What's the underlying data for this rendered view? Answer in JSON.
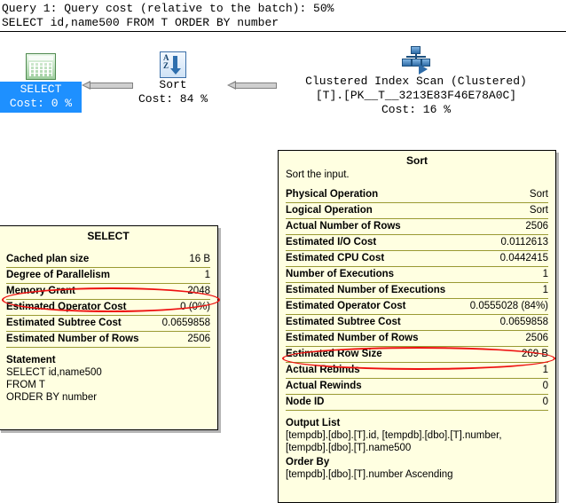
{
  "header": {
    "line1": "Query 1: Query cost (relative to the batch): 50%",
    "line2": "SELECT id,name500 FROM T ORDER BY number"
  },
  "plan": {
    "nodes": [
      {
        "id": "select",
        "icon": "select-result-icon",
        "label": "SELECT",
        "cost": "Cost: 0 %",
        "selected": true
      },
      {
        "id": "sort",
        "icon": "sort-az-icon",
        "label": "Sort",
        "cost": "Cost: 84 %"
      },
      {
        "id": "clustered-index-scan",
        "icon": "clustered-index-scan-icon",
        "label": "Clustered Index Scan (Clustered)",
        "object": "[T].[PK__T__3213E83F46E78A0C]",
        "cost": "Cost: 16 %"
      }
    ],
    "arrows": [
      {
        "id": "arrow-sort-to-select",
        "direction": "left"
      },
      {
        "id": "arrow-scan-to-sort",
        "direction": "left"
      }
    ]
  },
  "tooltip_select": {
    "title": "SELECT",
    "rows": [
      {
        "key": "Cached plan size",
        "value": "16 B"
      },
      {
        "key": "Degree of Parallelism",
        "value": "1"
      },
      {
        "key": "Memory Grant",
        "value": "2048",
        "highlighted": true
      },
      {
        "key": "Estimated Operator Cost",
        "value": "0 (0%)"
      },
      {
        "key": "Estimated Subtree Cost",
        "value": "0.0659858"
      },
      {
        "key": "Estimated Number of Rows",
        "value": "2506"
      }
    ],
    "statement": {
      "heading": "Statement",
      "line1": "SELECT id,name500",
      "line2": "FROM T",
      "line3": "ORDER BY number"
    }
  },
  "tooltip_sort": {
    "title": "Sort",
    "description": "Sort the input.",
    "rows": [
      {
        "key": "Physical Operation",
        "value": "Sort"
      },
      {
        "key": "Logical Operation",
        "value": "Sort"
      },
      {
        "key": "Actual Number of Rows",
        "value": "2506"
      },
      {
        "key": "Estimated I/O Cost",
        "value": "0.0112613"
      },
      {
        "key": "Estimated CPU Cost",
        "value": "0.0442415"
      },
      {
        "key": "Number of Executions",
        "value": "1"
      },
      {
        "key": "Estimated Number of Executions",
        "value": "1"
      },
      {
        "key": "Estimated Operator Cost",
        "value": "0.0555028 (84%)"
      },
      {
        "key": "Estimated Subtree Cost",
        "value": "0.0659858"
      },
      {
        "key": "Estimated Number of Rows",
        "value": "2506"
      },
      {
        "key": "Estimated Row Size",
        "value": "269 B",
        "highlighted": true
      },
      {
        "key": "Actual Rebinds",
        "value": "1"
      },
      {
        "key": "Actual Rewinds",
        "value": "0"
      },
      {
        "key": "Node ID",
        "value": "0"
      }
    ],
    "output_list": {
      "heading": "Output List",
      "line1": "[tempdb].[dbo].[T].id, [tempdb].[dbo].[T].number,",
      "line2": "[tempdb].[dbo].[T].name500"
    },
    "order_by": {
      "heading": "Order By",
      "line1": "[tempdb].[dbo].[T].number Ascending"
    }
  },
  "annotations": [
    {
      "id": "annot-memory-grant",
      "target": "Memory Grant",
      "color": "#ee1111",
      "shape": "ellipse"
    },
    {
      "id": "annot-row-size",
      "target": "Estimated Row Size",
      "color": "#ee1111",
      "shape": "ellipse"
    }
  ]
}
